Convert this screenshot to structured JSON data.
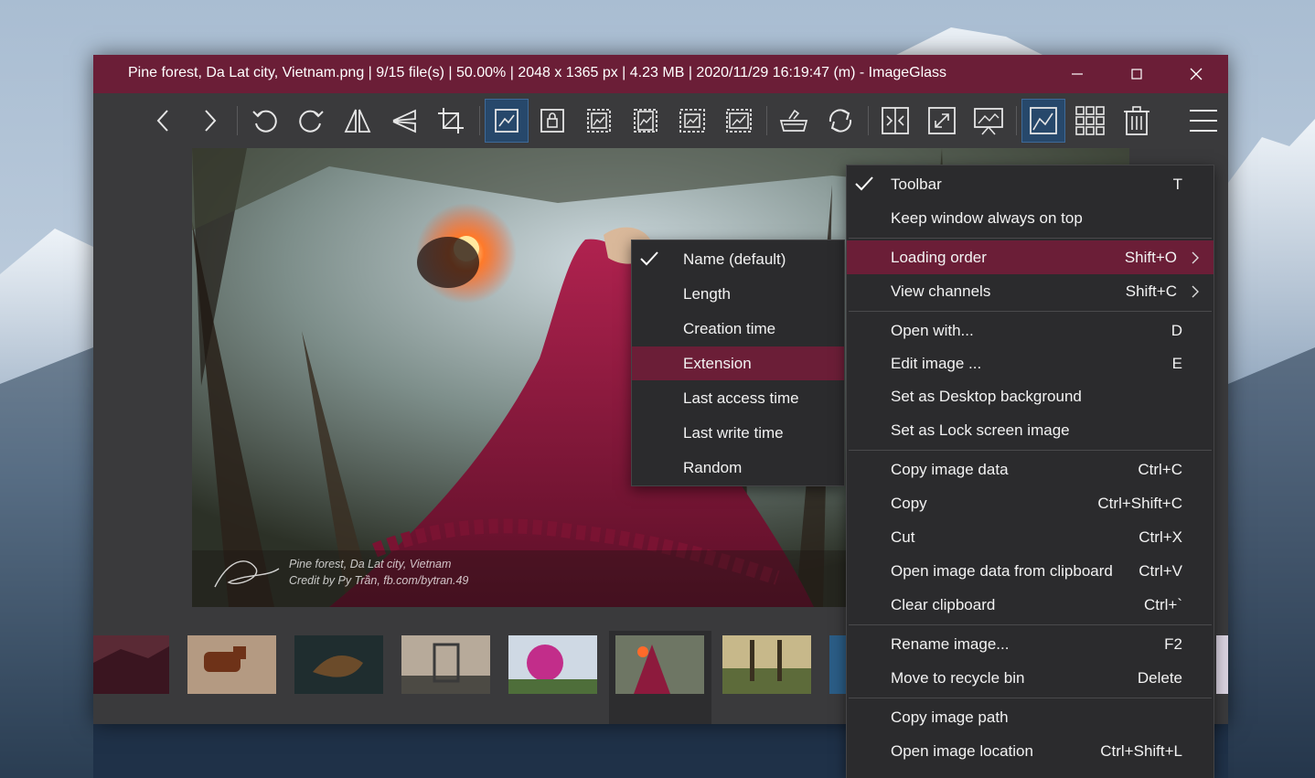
{
  "window": {
    "title": "Pine forest, Da Lat city, Vietnam.png  |  9/15 file(s)  |  50.00%  |  2048 x 1365 px  |  4.23 MB  |  2020/11/29 16:19:47 (m)  - ImageGlass",
    "controls": [
      "minimize-icon",
      "maximize-icon",
      "close-icon"
    ]
  },
  "toolbar": {
    "buttons": [
      "previous-icon",
      "next-icon",
      "rotate-left-icon",
      "rotate-right-icon",
      "flip-horizontal-icon",
      "flip-vertical-icon",
      "crop-icon",
      "auto-zoom-icon",
      "lock-zoom-icon",
      "scale-width-icon",
      "scale-height-icon",
      "scale-to-fit-icon",
      "scale-to-fill-icon",
      "color-picker-icon",
      "refresh-icon",
      "view-actual-size-icon",
      "fullscreen-icon",
      "slideshow-icon",
      "thumbnail-bar-icon",
      "checkerboard-icon",
      "delete-icon",
      "menu-icon"
    ],
    "active": [
      "auto-zoom-icon",
      "thumbnail-bar-icon"
    ]
  },
  "photo": {
    "credit_line1": "Pine forest, Da Lat city, Vietnam",
    "credit_line2": "Credit by Py Trần, fb.com/bytran.49"
  },
  "main_menu": {
    "items": [
      {
        "label": "Toolbar",
        "shortcut": "T",
        "checked": true
      },
      {
        "label": "Keep window always on top",
        "shortcut": ""
      },
      {
        "label": "Loading order",
        "shortcut": "Shift+O",
        "submenu": true,
        "highlighted": true
      },
      {
        "label": "View channels",
        "shortcut": "Shift+C",
        "submenu": true
      },
      {
        "label": "Open with...",
        "shortcut": "D"
      },
      {
        "label": "Edit image ...",
        "shortcut": "E"
      },
      {
        "label": "Set as Desktop background",
        "shortcut": ""
      },
      {
        "label": "Set as Lock screen image",
        "shortcut": ""
      },
      {
        "label": "Copy image data",
        "shortcut": "Ctrl+C"
      },
      {
        "label": "Copy",
        "shortcut": "Ctrl+Shift+C"
      },
      {
        "label": "Cut",
        "shortcut": "Ctrl+X"
      },
      {
        "label": "Open image data from clipboard",
        "shortcut": "Ctrl+V"
      },
      {
        "label": "Clear clipboard",
        "shortcut": "Ctrl+`"
      },
      {
        "label": "Rename image...",
        "shortcut": "F2"
      },
      {
        "label": "Move to recycle bin",
        "shortcut": "Delete"
      },
      {
        "label": "Copy image path",
        "shortcut": ""
      },
      {
        "label": "Open image location",
        "shortcut": "Ctrl+Shift+L"
      }
    ]
  },
  "loading_order_menu": {
    "items": [
      {
        "label": "Name (default)",
        "checked": true
      },
      {
        "label": "Length"
      },
      {
        "label": "Creation time"
      },
      {
        "label": "Extension",
        "highlighted": true
      },
      {
        "label": "Last access time"
      },
      {
        "label": "Last write time"
      },
      {
        "label": "Random"
      }
    ]
  },
  "colors": {
    "accent": "#6b1e37",
    "window_bg": "#3a3a3c",
    "menu_bg": "#2b2b2d",
    "active_button": "#27486b"
  }
}
